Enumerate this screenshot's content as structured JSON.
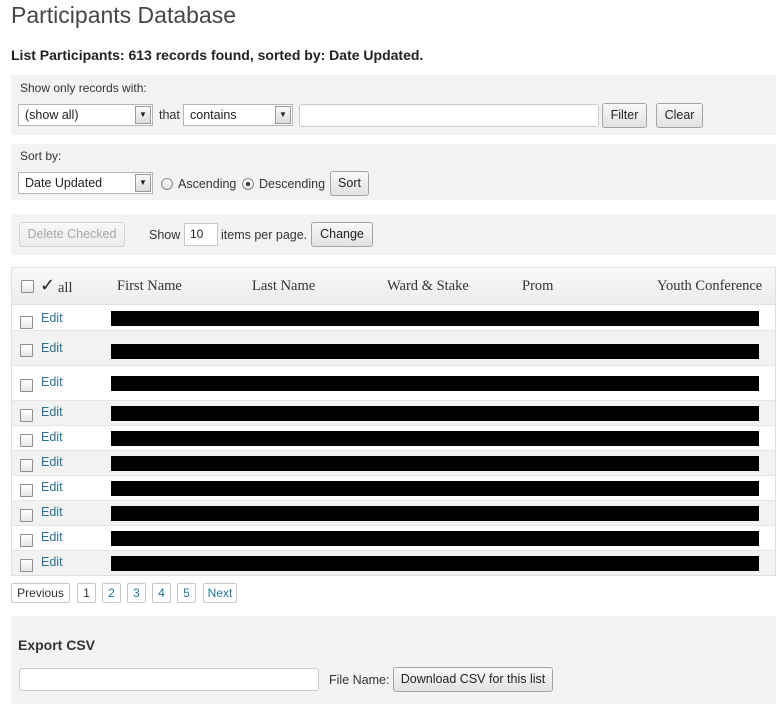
{
  "page": {
    "title": "Participants Database",
    "subtitle": "List Participants: 613 records found, sorted by: Date Updated."
  },
  "filter": {
    "label": "Show only records with:",
    "field_select": "(show all)",
    "that_label": "that",
    "operator_select": "contains",
    "search_value": "",
    "filter_button": "Filter",
    "clear_button": "Clear"
  },
  "sort": {
    "label": "Sort by:",
    "field_select": "Date Updated",
    "ascending_label": "Ascending",
    "descending_label": "Descending",
    "selected": "Descending",
    "sort_button": "Sort"
  },
  "actions": {
    "delete_button": "Delete Checked",
    "show_label": "Show",
    "per_page_value": "10",
    "per_page_label": "items per page.",
    "change_button": "Change"
  },
  "table": {
    "select_all_label": "all",
    "columns": [
      "First Name",
      "Last Name",
      "Ward & Stake",
      "Prom",
      "Youth Conference"
    ],
    "rows": [
      {
        "edit": "Edit"
      },
      {
        "edit": "Edit"
      },
      {
        "edit": "Edit"
      },
      {
        "edit": "Edit"
      },
      {
        "edit": "Edit"
      },
      {
        "edit": "Edit"
      },
      {
        "edit": "Edit"
      },
      {
        "edit": "Edit"
      },
      {
        "edit": "Edit"
      },
      {
        "edit": "Edit"
      }
    ]
  },
  "pagination": {
    "previous": "Previous",
    "pages": [
      "1",
      "2",
      "3",
      "4",
      "5"
    ],
    "current": "1",
    "next": "Next"
  },
  "export": {
    "title": "Export CSV",
    "filename_value": "",
    "file_name_label": "File Name:",
    "download_button": "Download CSV for this list"
  },
  "colors": {
    "link": "#21759b",
    "panel_bg": "#f3f3f3",
    "redaction": "#000000"
  }
}
